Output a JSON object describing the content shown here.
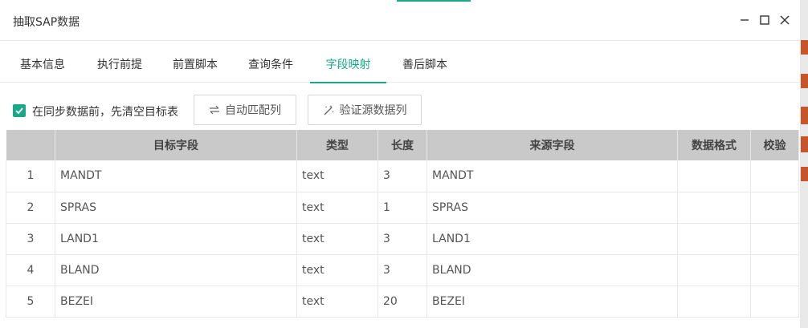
{
  "dialog": {
    "title": "抽取SAP数据"
  },
  "tabs": [
    {
      "label": "基本信息"
    },
    {
      "label": "执行前提"
    },
    {
      "label": "前置脚本"
    },
    {
      "label": "查询条件"
    },
    {
      "label": "字段映射"
    },
    {
      "label": "善后脚本"
    }
  ],
  "active_tab": "字段映射",
  "toolbar": {
    "clear_checkbox_label": "在同步数据前，先清空目标表",
    "clear_checkbox_checked": true,
    "auto_match_label": "自动匹配列",
    "verify_source_label": "验证源数据列"
  },
  "table": {
    "headers": [
      "",
      "目标字段",
      "类型",
      "长度",
      "来源字段",
      "数据格式",
      "校验"
    ],
    "rows": [
      {
        "idx": "1",
        "target": "MANDT",
        "type": "text",
        "length": "3",
        "source": "MANDT",
        "format": "",
        "check": ""
      },
      {
        "idx": "2",
        "target": "SPRAS",
        "type": "text",
        "length": "1",
        "source": "SPRAS",
        "format": "",
        "check": ""
      },
      {
        "idx": "3",
        "target": "LAND1",
        "type": "text",
        "length": "3",
        "source": "LAND1",
        "format": "",
        "check": ""
      },
      {
        "idx": "4",
        "target": "BLAND",
        "type": "text",
        "length": "3",
        "source": "BLAND",
        "format": "",
        "check": ""
      },
      {
        "idx": "5",
        "target": "BEZEI",
        "type": "text",
        "length": "20",
        "source": "BEZEI",
        "format": "",
        "check": ""
      }
    ]
  },
  "colors": {
    "accent": "#1aa88a",
    "header_bg": "#c9c9c9"
  },
  "icons": [
    "minimize-icon",
    "maximize-icon",
    "close-icon",
    "check-icon",
    "swap-arrows-icon",
    "magic-wand-icon"
  ]
}
